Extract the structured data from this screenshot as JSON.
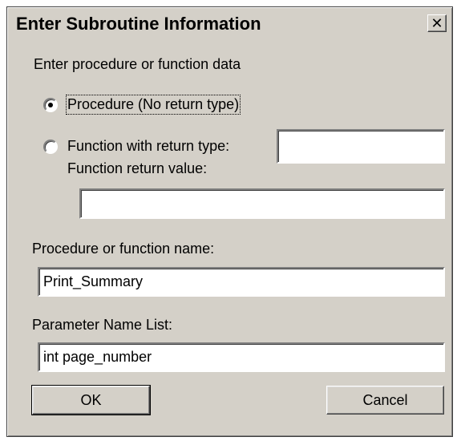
{
  "dialog": {
    "title": "Enter Subroutine Information",
    "close_label": "✕"
  },
  "section": {
    "heading": "Enter procedure or function data"
  },
  "options": {
    "procedure_label": "Procedure (No return type)",
    "procedure_selected": true,
    "function_label": "Function with return type:",
    "function_selected": false,
    "return_type_value": "",
    "return_value_label": "Function return value:",
    "return_value_value": ""
  },
  "name_field": {
    "label": "Procedure or function name:",
    "value": "Print_Summary"
  },
  "params_field": {
    "label": "Parameter Name List:",
    "value": "int page_number"
  },
  "buttons": {
    "ok_label": "OK",
    "cancel_label": "Cancel"
  }
}
